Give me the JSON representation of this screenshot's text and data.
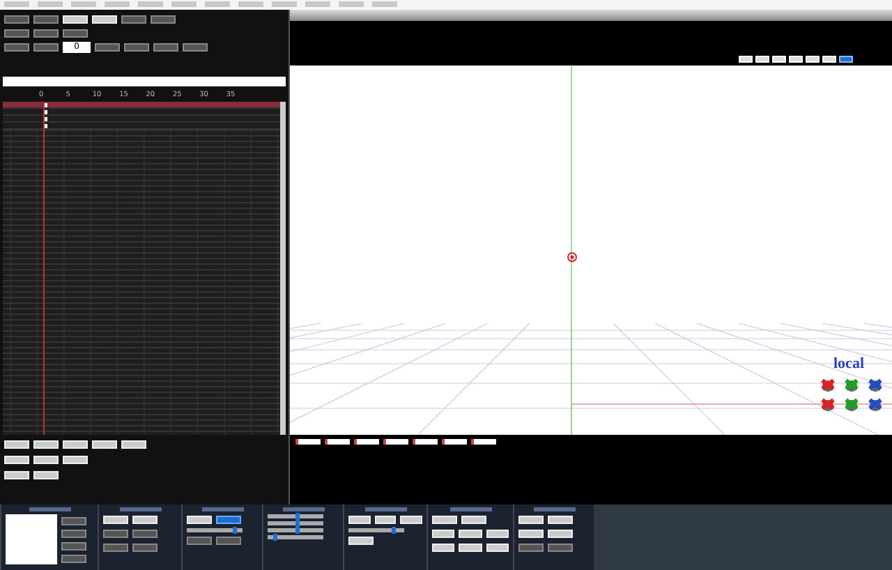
{
  "timeline": {
    "frame": "0",
    "ticks": [
      "0",
      "5",
      "10",
      "15",
      "20",
      "25",
      "30",
      "35"
    ],
    "rows": [
      {
        "selected": true
      },
      {
        "selected": false
      },
      {
        "selected": false
      },
      {
        "selected": false
      }
    ]
  },
  "viewport": {
    "axis_label": "local",
    "view_buttons": [
      {
        "selected": false
      },
      {
        "selected": false
      },
      {
        "selected": false
      },
      {
        "selected": false
      },
      {
        "selected": false
      },
      {
        "selected": false
      },
      {
        "selected": true
      }
    ],
    "sliders": [
      {
        "level": 0.9
      },
      {
        "level": 0.55
      },
      {
        "level": 0.55
      },
      {
        "level": 0.55
      },
      {
        "level": 0.1
      },
      {
        "level": 0.85
      }
    ],
    "gizmos": [
      {
        "color": "#e02020"
      },
      {
        "color": "#20a020"
      },
      {
        "color": "#2050c0"
      },
      {
        "color": "#e02020"
      },
      {
        "color": "#20a020"
      },
      {
        "color": "#2050c0"
      }
    ]
  }
}
